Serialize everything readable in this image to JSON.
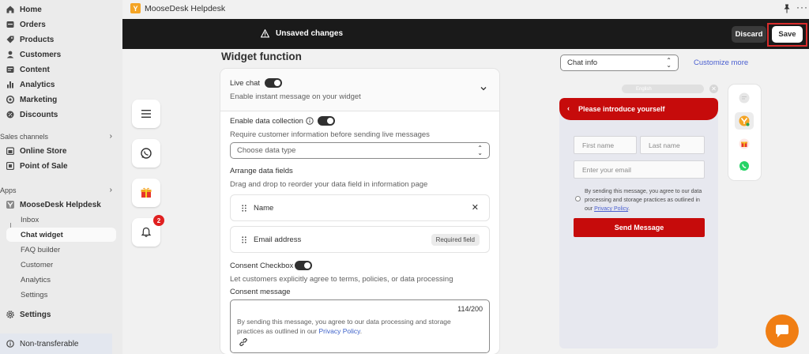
{
  "topbar": {
    "app_title": "MooseDesk Helpdesk"
  },
  "savebar": {
    "message": "Unsaved changes",
    "discard_label": "Discard",
    "save_label": "Save"
  },
  "sidebar": {
    "items": [
      {
        "label": "Home",
        "icon": "home-icon"
      },
      {
        "label": "Orders",
        "icon": "orders-icon"
      },
      {
        "label": "Products",
        "icon": "tag-icon"
      },
      {
        "label": "Customers",
        "icon": "person-icon"
      },
      {
        "label": "Content",
        "icon": "content-icon"
      },
      {
        "label": "Analytics",
        "icon": "analytics-icon"
      },
      {
        "label": "Marketing",
        "icon": "marketing-icon"
      },
      {
        "label": "Discounts",
        "icon": "discount-icon"
      }
    ],
    "sales_channels_label": "Sales channels",
    "sales_channels": [
      {
        "label": "Online Store",
        "icon": "store-icon"
      },
      {
        "label": "Point of Sale",
        "icon": "pos-icon"
      }
    ],
    "apps_label": "Apps",
    "app_name": "MooseDesk Helpdesk",
    "app_subitems": [
      "Inbox",
      "Chat widget",
      "FAQ builder",
      "Customer",
      "Analytics",
      "Settings"
    ],
    "settings_label": "Settings",
    "non_transferable_label": "Non-transferable"
  },
  "widget": {
    "title": "Widget function",
    "live_chat_label": "Live chat",
    "live_chat_desc": "Enable instant message on your widget",
    "data_collection_label": "Enable data collection",
    "data_collection_desc": "Require customer information before sending live messages",
    "data_type_placeholder": "Choose data type",
    "arrange_label": "Arrange data fields",
    "arrange_desc": "Drag and drop to reorder your data field in information page",
    "fields": [
      {
        "name": "Name",
        "tag": ""
      },
      {
        "name": "Email address",
        "tag": "Required field"
      }
    ],
    "consent_checkbox_label": "Consent Checkbox",
    "consent_checkbox_desc": "Let customers explicitly agree to terms, policies, or data processing",
    "consent_message_label": "Consent message",
    "consent_counter": "114/200",
    "consent_text_prefix": "By sending this message, you agree to our data processing and storage practices as outlined in our ",
    "consent_link": "Privacy Policy",
    "consent_text_suffix": "."
  },
  "side_buttons": {
    "notification_count": "2"
  },
  "preview": {
    "chat_info_select": "Chat info",
    "customize_link": "Customize more",
    "language": "English",
    "header_title": "Please introduce yourself",
    "first_name_placeholder": "First name",
    "last_name_placeholder": "Last name",
    "email_placeholder": "Enter your email",
    "consent_prefix": "By sending this message, you agree to our data processing and storage practices as outlined in our ",
    "consent_link": "Privacy Policy",
    "consent_suffix": ".",
    "send_label": "Send Message"
  },
  "colors": {
    "accent_red": "#c60b0b",
    "fab_orange": "#f07e14",
    "save_outline": "#d82c2c"
  }
}
